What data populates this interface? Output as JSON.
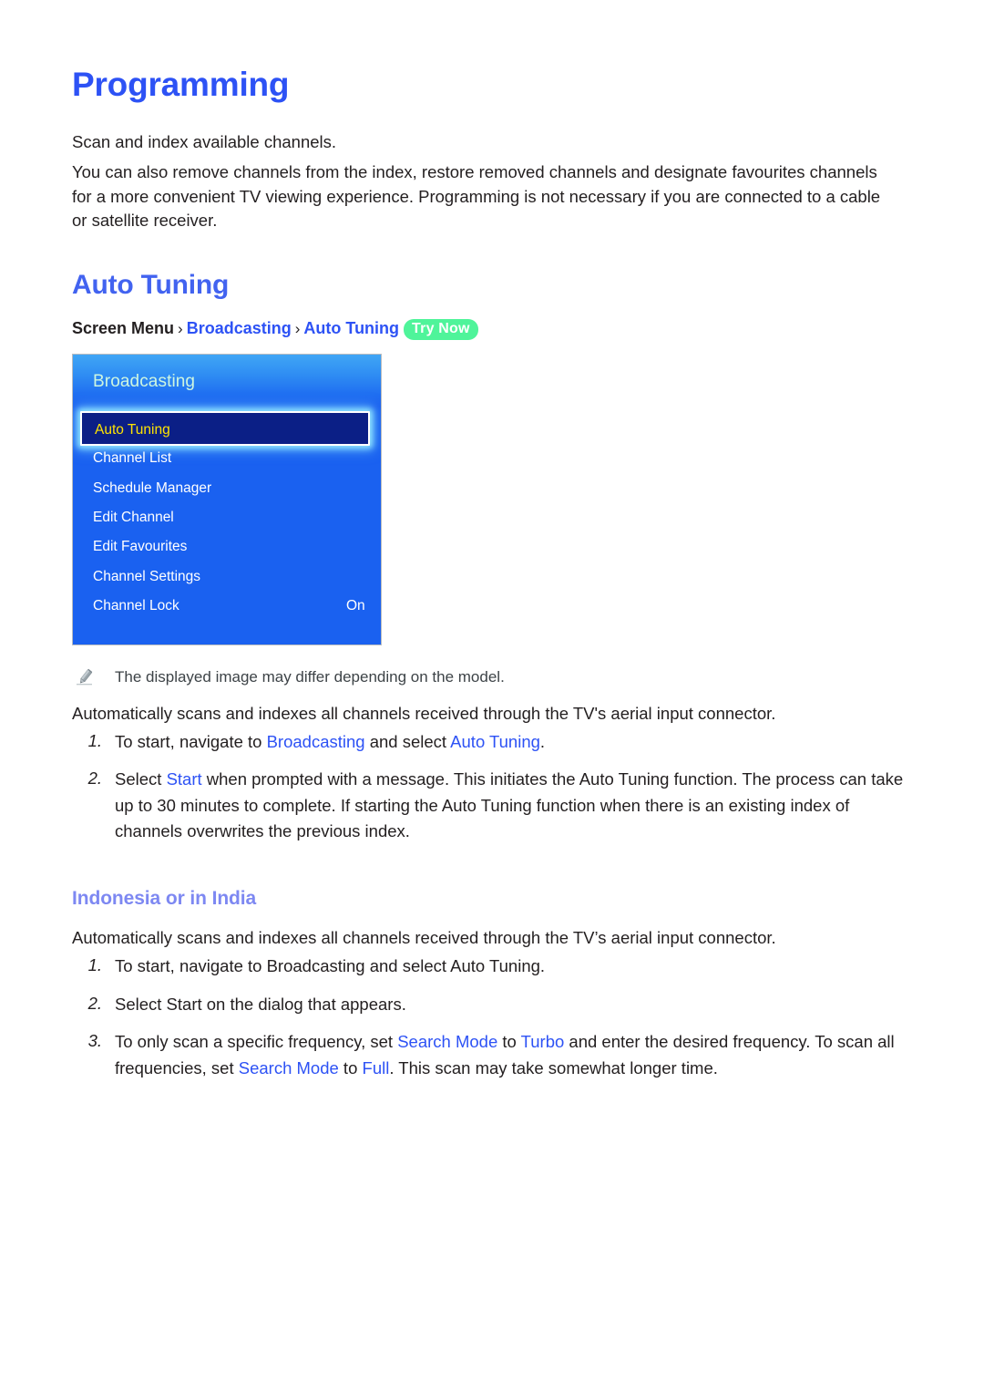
{
  "page": {
    "title": "Programming",
    "intro_1": "Scan and index available channels.",
    "intro_2": "You can also remove channels from the index, restore removed channels and designate favourites channels for a more convenient TV viewing experience. Programming is not necessary if you are connected to a cable or satellite receiver."
  },
  "colors": {
    "title_blue": "#2d52f5",
    "section_blue": "#4263f0",
    "sub_blue": "#7d88f2",
    "link_blue": "#2d52f5",
    "badge_green": "#4ff49a",
    "menu_blue": "#1a61f0",
    "highlight_navy": "#0b1f86",
    "highlight_yellow": "#ffe400",
    "menu_header_cyan": "#cdf6e0"
  },
  "section": {
    "heading": "Auto Tuning",
    "breadcrumb": {
      "root": "Screen Menu",
      "sep": "›",
      "level1": "Broadcasting",
      "level2": "Auto Tuning",
      "badge": "Try Now"
    },
    "note": "The displayed image may differ depending on the model.",
    "note_icon": "pencil-icon",
    "lead": "Automatically scans and indexes all channels received through the TV's aerial input connector.",
    "steps": [
      {
        "num": "1.",
        "parts": [
          {
            "t": "To start, navigate to ",
            "hl": false
          },
          {
            "t": "Broadcasting",
            "hl": true
          },
          {
            "t": " and select ",
            "hl": false
          },
          {
            "t": "Auto Tuning",
            "hl": true
          },
          {
            "t": ".",
            "hl": false
          }
        ]
      },
      {
        "num": "2.",
        "parts": [
          {
            "t": "Select ",
            "hl": false
          },
          {
            "t": "Start",
            "hl": true
          },
          {
            "t": " when prompted with a message. This initiates the Auto Tuning function. The process can take up to 30 minutes to complete. If starting the Auto Tuning function when there is an existing index of channels overwrites the previous index.",
            "hl": false
          }
        ]
      }
    ]
  },
  "tv_menu": {
    "header_title": "Broadcasting",
    "items": [
      {
        "label": "Auto Tuning",
        "value": "",
        "selected": true
      },
      {
        "label": "Channel List",
        "value": "",
        "selected": false
      },
      {
        "label": "Schedule Manager",
        "value": "",
        "selected": false
      },
      {
        "label": "Edit Channel",
        "value": "",
        "selected": false
      },
      {
        "label": "Edit Favourites",
        "value": "",
        "selected": false
      },
      {
        "label": "Channel Settings",
        "value": "",
        "selected": false
      },
      {
        "label": "Channel Lock",
        "value": "On",
        "selected": false
      }
    ]
  },
  "subsection": {
    "heading": "Indonesia or in India",
    "lead": "Automatically scans and indexes all channels received through the TV’s aerial input connector.",
    "steps": [
      {
        "num": "1.",
        "parts": [
          {
            "t": "To start, navigate to Broadcasting and select Auto Tuning.",
            "hl": false
          }
        ]
      },
      {
        "num": "2.",
        "parts": [
          {
            "t": "Select Start on the dialog that appears.",
            "hl": false
          }
        ]
      },
      {
        "num": "3.",
        "parts": [
          {
            "t": "To only scan a specific frequency, set ",
            "hl": false
          },
          {
            "t": "Search Mode",
            "hl": true
          },
          {
            "t": " to ",
            "hl": false
          },
          {
            "t": "Turbo",
            "hl": true
          },
          {
            "t": " and enter the desired frequency. To scan all frequencies, set ",
            "hl": false
          },
          {
            "t": "Search Mode",
            "hl": true
          },
          {
            "t": " to ",
            "hl": false
          },
          {
            "t": "Full",
            "hl": true
          },
          {
            "t": ". This scan may take somewhat longer time.",
            "hl": false
          }
        ]
      }
    ]
  }
}
